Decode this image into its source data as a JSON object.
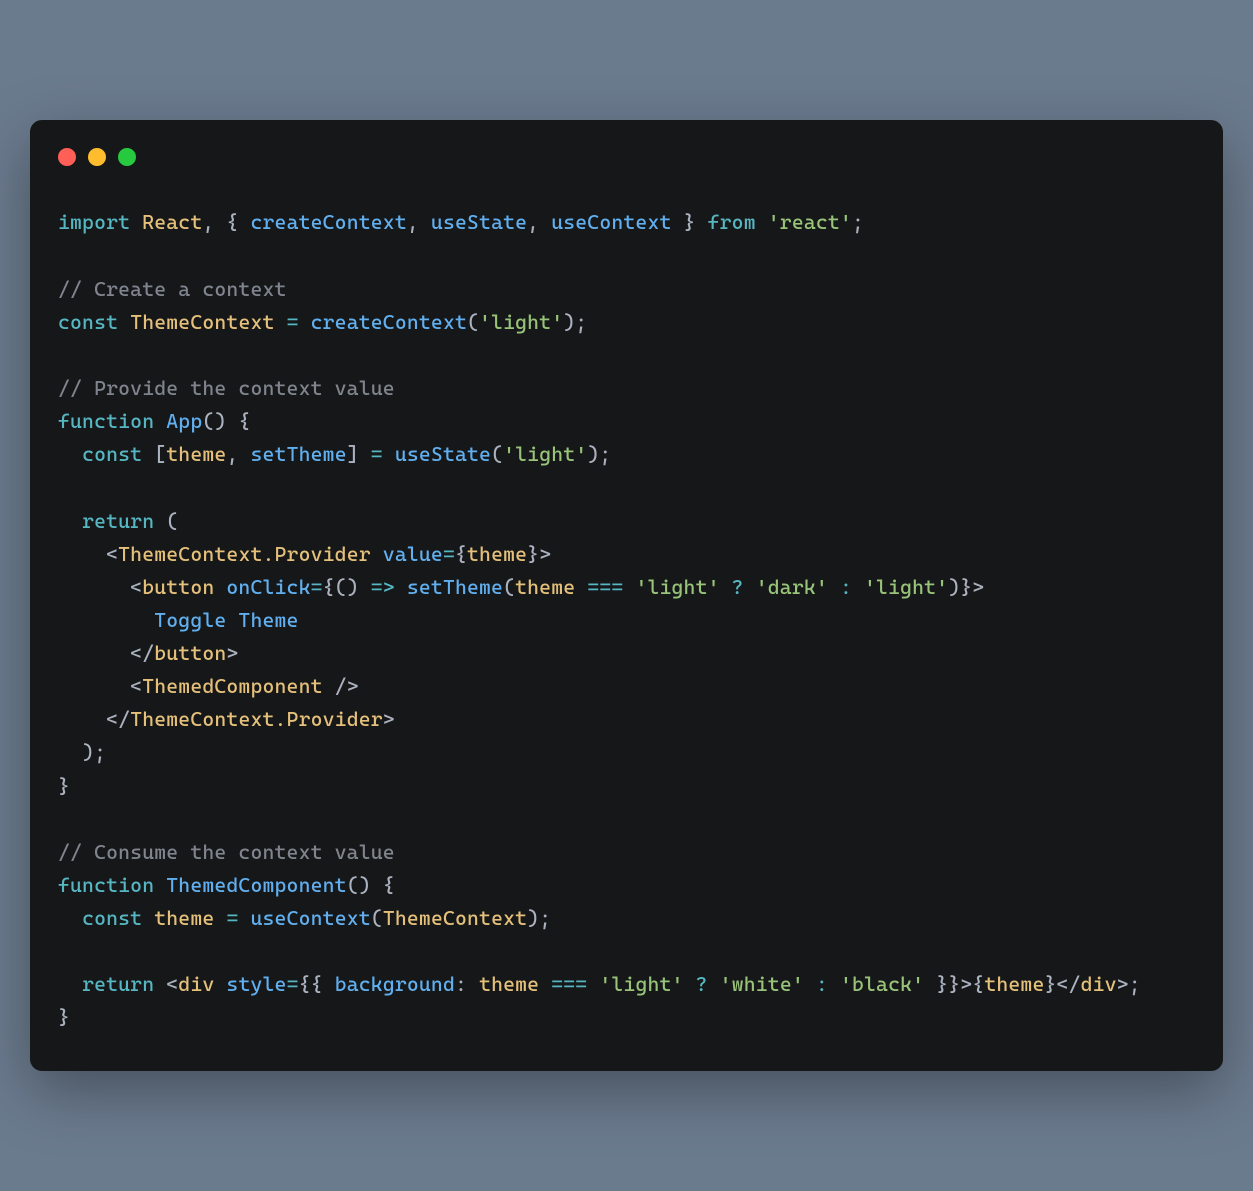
{
  "window": {
    "traffic_lights": [
      "red",
      "yellow",
      "green"
    ]
  },
  "code": {
    "l1": {
      "t1": "import",
      "t2": "React",
      "t3": ", { ",
      "t4": "createContext",
      "t5": ", ",
      "t6": "useState",
      "t7": ", ",
      "t8": "useContext",
      "t9": " } ",
      "t10": "from",
      "t11": " ",
      "t12": "'react'",
      "t13": ";"
    },
    "l3": {
      "t1": "// Create a context"
    },
    "l4": {
      "t1": "const",
      "t2": " ",
      "t3": "ThemeContext",
      "t4": " ",
      "t5": "=",
      "t6": " ",
      "t7": "createContext",
      "t8": "(",
      "t9": "'light'",
      "t10": ");"
    },
    "l6": {
      "t1": "// Provide the context value"
    },
    "l7": {
      "t1": "function",
      "t2": " ",
      "t3": "App",
      "t4": "() {"
    },
    "l8": {
      "t1": "  ",
      "t2": "const",
      "t3": " [",
      "t4": "theme",
      "t5": ", ",
      "t6": "setTheme",
      "t7": "] ",
      "t8": "=",
      "t9": " ",
      "t10": "useState",
      "t11": "(",
      "t12": "'light'",
      "t13": ");"
    },
    "l10": {
      "t1": "  ",
      "t2": "return",
      "t3": " ("
    },
    "l11": {
      "t1": "    <",
      "t2": "ThemeContext.Provider",
      "t3": " ",
      "t4": "value",
      "t5": "=",
      "t6": "{",
      "t7": "theme",
      "t8": "}>"
    },
    "l12": {
      "t1": "      <",
      "t2": "button",
      "t3": " ",
      "t4": "onClick",
      "t5": "=",
      "t6": "{() ",
      "t7": "=>",
      "t8": " ",
      "t9": "setTheme",
      "t10": "(",
      "t11": "theme",
      "t12": " ",
      "t13": "===",
      "t14": " ",
      "t15": "'light'",
      "t16": " ",
      "t17": "?",
      "t18": " ",
      "t19": "'dark'",
      "t20": " ",
      "t21": ":",
      "t22": " ",
      "t23": "'light'",
      "t24": ")}>"
    },
    "l13": {
      "t1": "        Toggle Theme"
    },
    "l14": {
      "t1": "      </",
      "t2": "button",
      "t3": ">"
    },
    "l15": {
      "t1": "      <",
      "t2": "ThemedComponent",
      "t3": " />"
    },
    "l16": {
      "t1": "    </",
      "t2": "ThemeContext.Provider",
      "t3": ">"
    },
    "l17": {
      "t1": "  );"
    },
    "l18": {
      "t1": "}"
    },
    "l20": {
      "t1": "// Consume the context value"
    },
    "l21": {
      "t1": "function",
      "t2": " ",
      "t3": "ThemedComponent",
      "t4": "() {"
    },
    "l22": {
      "t1": "  ",
      "t2": "const",
      "t3": " ",
      "t4": "theme",
      "t5": " ",
      "t6": "=",
      "t7": " ",
      "t8": "useContext",
      "t9": "(",
      "t10": "ThemeContext",
      "t11": ");"
    },
    "l24": {
      "t1": "  ",
      "t2": "return",
      "t3": " <",
      "t4": "div",
      "t5": " ",
      "t6": "style",
      "t7": "=",
      "t8": "{{ ",
      "t9": "background",
      "t10": ": ",
      "t11": "theme",
      "t12": " ",
      "t13": "===",
      "t14": " ",
      "t15": "'light'",
      "t16": " ",
      "t17": "?",
      "t18": " ",
      "t19": "'white'",
      "t20": " ",
      "t21": ":",
      "t22": " ",
      "t23": "'black'",
      "t24": " }}>{",
      "t25": "theme",
      "t26": "}</",
      "t27": "div",
      "t28": ">;"
    },
    "l25": {
      "t1": "}"
    }
  }
}
